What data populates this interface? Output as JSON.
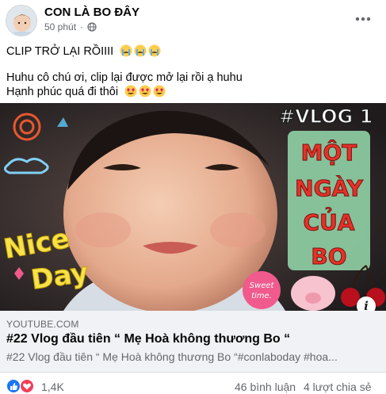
{
  "post": {
    "author": "CON LÀ BO ĐÂY",
    "time": "50 phút",
    "caption_line1": "CLIP TRỞ LẠI RỒIIII",
    "caption_line2": "Huhu cô chú ơi, clip lại được mở lại rồi ạ huhu",
    "caption_line3": "Hạnh phúc quá đi thôi"
  },
  "thumbnail": {
    "tag": "#VLOG 1",
    "title_words": [
      "MỘT",
      "NGÀY",
      "CỦA",
      "BO"
    ],
    "sticker_left": "Nice Day",
    "sticker_tag": "Sweet time."
  },
  "link": {
    "domain": "YOUTUBE.COM",
    "title": "#22 Vlog đầu tiên “ Mẹ Hoà không thương Bo “",
    "description": "#22 Vlog đầu tiên “ Mẹ Hoà không thương Bo “#conlaboday #hoa..."
  },
  "stats": {
    "reaction_count": "1,4K",
    "comments": "46 bình luận",
    "shares": "4 lượt chia sẻ"
  },
  "colors": {
    "like_blue": "#1877f2",
    "love_red": "#f33e58",
    "title_red": "#e5312a",
    "panel_green": "#8bc9a0"
  },
  "icons": {
    "globe": "globe-icon",
    "more": "more-dots-icon",
    "info": "info-icon",
    "like": "like-icon",
    "love": "love-icon"
  }
}
